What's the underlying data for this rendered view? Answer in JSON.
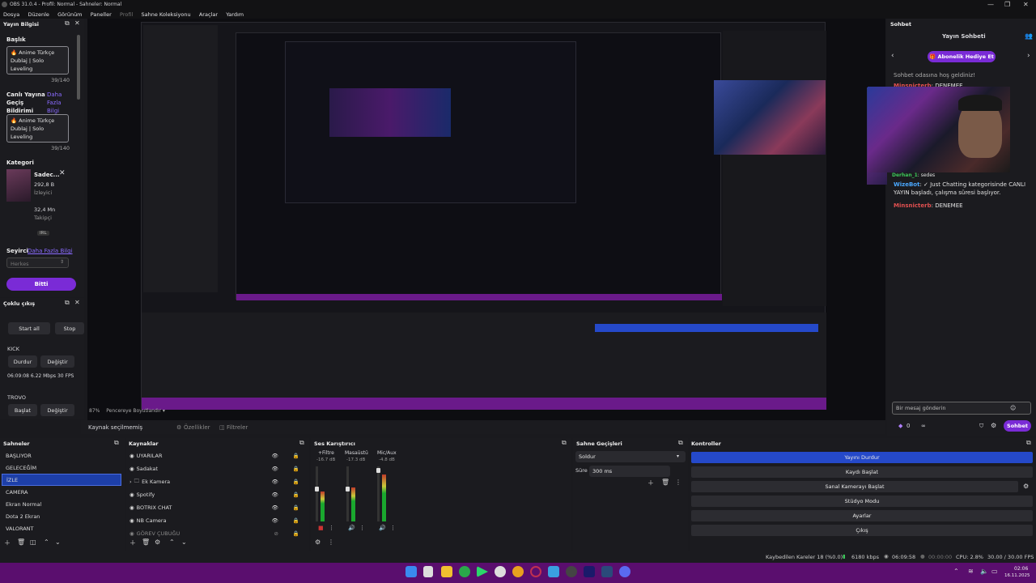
{
  "window": {
    "title": "OBS 31.0.4 - Profil: Normal - Sahneler: Normal",
    "min": "—",
    "max": "❐",
    "close": "✕"
  },
  "menu": [
    "Dosya",
    "Düzenle",
    "Görünüm",
    "Paneller",
    "Profil",
    "Sahne Koleksiyonu",
    "Araçlar",
    "Yardım"
  ],
  "stream_info": {
    "title": "Yayın Bilgisi",
    "baslik_label": "Başlık",
    "baslik_value": "🔥 Anime Türkçe Dublaj | Solo Leveling",
    "baslik_count": "39/140",
    "notif_label": "Canlı Yayına Geçiş Bildirimi",
    "notif_more": "Daha Fazla Bilgi",
    "notif_value": "🔥 Anime Türkçe Dublaj | Solo Leveling",
    "notif_count": "39/140",
    "kategori_label": "Kategori",
    "kategori_name": "Sadec...",
    "kategori_viewers": "292,8 B",
    "kategori_viewers_label": "İzleyici",
    "kategori_followers": "32,4 Mn",
    "kategori_followers_label": "Takipçi",
    "kategori_tag": "IRL",
    "seyirci_label": "Seyirci",
    "seyirci_more": "Daha Fazla Bilgi",
    "seyirci_value": "Herkes",
    "done_button": "Bitti"
  },
  "multi": {
    "title": "Çoklu çıkış",
    "start_all": "Start all",
    "stop": "Stop",
    "kick_label": "KICK",
    "durdur": "Durdur",
    "degistir": "Değiştir",
    "kick_stats": "06:09:08  6.22 Mbps  30 FPS",
    "trovo_label": "TROVO",
    "baslat": "Başlat",
    "degistir2": "Değiştir"
  },
  "preview_bar": {
    "zoom": "87%",
    "fit": "Pencereye Boyutlandır",
    "no_source": "Kaynak seçilmemiş",
    "props": "Özellikler",
    "filters": "Filtreler"
  },
  "chat": {
    "title": "Sohbet",
    "header": "Yayın Sohbeti",
    "gift_button": "Abonelik Hediye Et",
    "welcome": "Sohbet odasına hoş geldiniz!",
    "messages": [
      {
        "user": "Minsnicterb",
        "text": "DENEMEE",
        "color": "#e05050"
      },
      {
        "user": "Derhan_1",
        "text": "sedes",
        "color": "#3cc85a"
      },
      {
        "user": "WizeBot",
        "text": "✓ Just Chatting kategorisinde CANLI YAYIN başladı, çalışma süresi başlıyor.",
        "color": "#4aa8ff"
      },
      {
        "user": "Minsnicterb",
        "text": "DENEMEE",
        "color": "#e05050"
      }
    ],
    "input_placeholder": "Bir mesaj gönderin",
    "points": "0",
    "inf": "∞",
    "send_button": "Sohbet"
  },
  "scenes": {
    "title": "Sahneler",
    "items": [
      "BAŞLIYOR",
      "GELECEĞİM",
      "İZLE",
      "CAMERA",
      "Ekran Normal",
      "Dota 2 Ekran",
      "VALORANT"
    ],
    "selected": 2
  },
  "sources": {
    "title": "Kaynaklar",
    "items": [
      "UYARILAR",
      "Sadakat",
      "Ek Kamera",
      "Spotify",
      "BOTRIX CHAT",
      "NB Camera",
      "GÖREV ÇUBUĞU"
    ]
  },
  "mixer": {
    "title": "Ses Karıştırıcı",
    "channels": [
      {
        "name": "+Filtre",
        "db": "-16.7 dB",
        "level": 0.55
      },
      {
        "name": "Masaüstü",
        "db": "-17.3 dB",
        "level": 0.62
      },
      {
        "name": "Mic/Aux",
        "db": "-4.8 dB",
        "level": 0.85
      }
    ],
    "scale": [
      "5",
      "0",
      "-5",
      "-10",
      "-15",
      "-20",
      "-25",
      "-30",
      "-35",
      "-40",
      "-45",
      "-50",
      "-55",
      "-60"
    ]
  },
  "transitions": {
    "title": "Sahne Geçişleri",
    "type": "Soldur",
    "duration_label": "Süre",
    "duration_value": "300 ms"
  },
  "controls": {
    "title": "Kontroller",
    "buttons": [
      "Yayını Durdur",
      "Kaydı Başlat",
      "Sanal Kamerayı Başlat",
      "Stüdyo Modu",
      "Ayarlar",
      "Çıkış"
    ]
  },
  "status": {
    "dropped": "Kaybedilen Kareler 18 (%0.0)",
    "bitrate": "6180 kbps",
    "stream_time": "06:09:58",
    "rec_time": "00:00:00",
    "cpu": "CPU: 2.8%",
    "fps": "30.00 / 30.00 FPS"
  },
  "clock": {
    "time": "02:06",
    "date": "16.11.2025"
  }
}
